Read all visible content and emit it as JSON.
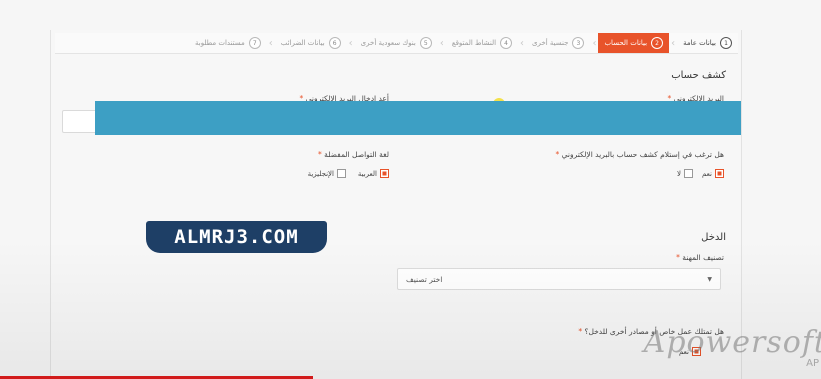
{
  "steps": [
    {
      "label": "بيانات عامة",
      "num": "1",
      "state": "done"
    },
    {
      "label": "بيانات الحساب",
      "num": "2",
      "state": "active"
    },
    {
      "label": "جنسية أخرى",
      "num": "3",
      "state": "pending"
    },
    {
      "label": "النشاط المتوقع",
      "num": "4",
      "state": "pending"
    },
    {
      "label": "بنوك سعودية أخرى",
      "num": "5",
      "state": "pending"
    },
    {
      "label": "بيانات الضرائب",
      "num": "6",
      "state": "pending"
    },
    {
      "label": "مستندات مطلوبة",
      "num": "7",
      "state": "pending"
    }
  ],
  "account_statement": {
    "heading": "كشف حساب",
    "email_label": "البريد الإلكتروني",
    "email_confirm_label": "أعد إدخال البريد الإلكتروني",
    "receive_question": "هل ترغب في إستلام كشف حساب بالبريد الإلكتروني",
    "yes": "نعم",
    "no": "لا",
    "pref_lang_label": "لغة التواصل المفضلة",
    "lang_arabic": "العربية",
    "lang_english": "الإنجليزية"
  },
  "income": {
    "heading": "الدخل",
    "profession_label": "تصنيف المهنة",
    "profession_placeholder": "اختر تصنيف",
    "other_income_question": "هل تمتلك عمل خاص أو مصادر أخرى للدخل؟",
    "yes": "نعم"
  },
  "logo_text": "ALMRJ3.COM",
  "watermark": "Apowersoft",
  "watermark_sub": "AP",
  "required_mark": "*",
  "colors": {
    "accent": "#e8532a",
    "band": "#3d9fc4",
    "logo_bg": "#1e3f66"
  }
}
